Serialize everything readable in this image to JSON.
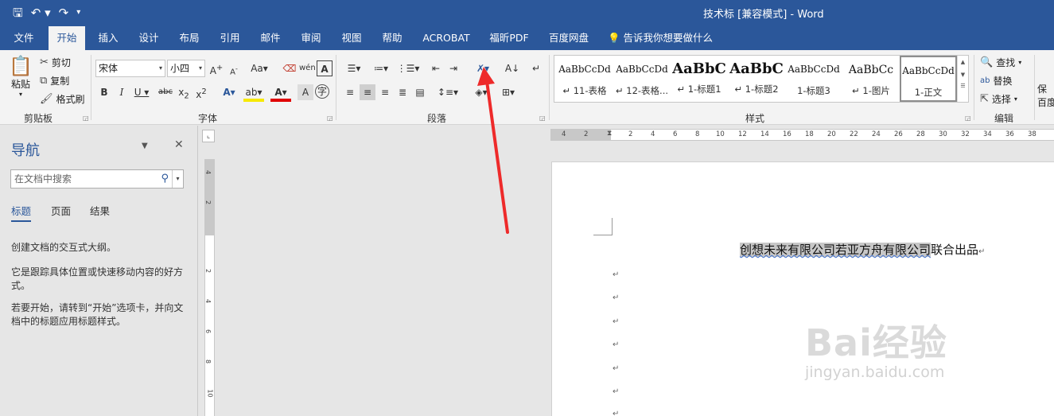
{
  "title_bar": {
    "title": "技术标 [兼容模式] - Word",
    "qat_icons": [
      "save-icon",
      "undo-icon",
      "redo-icon",
      "customize-icon"
    ]
  },
  "tabs": [
    {
      "label": "文件"
    },
    {
      "label": "开始"
    },
    {
      "label": "插入"
    },
    {
      "label": "设计"
    },
    {
      "label": "布局"
    },
    {
      "label": "引用"
    },
    {
      "label": "邮件"
    },
    {
      "label": "审阅"
    },
    {
      "label": "视图"
    },
    {
      "label": "帮助"
    },
    {
      "label": "ACROBAT"
    },
    {
      "label": "福昕PDF"
    },
    {
      "label": "百度网盘"
    }
  ],
  "tell_me": "告诉我你想要做什么",
  "ribbon": {
    "clipboard": {
      "paste": "粘贴",
      "cut": "剪切",
      "copy": "复制",
      "format_painter": "格式刷",
      "label": "剪贴板"
    },
    "font": {
      "font_name": "宋体",
      "font_size": "小四",
      "label": "字体"
    },
    "paragraph": {
      "label": "段落"
    },
    "styles": {
      "label": "样式",
      "items": [
        {
          "preview": "AaBbCcDd",
          "name": "↵ 11-表格"
        },
        {
          "preview": "AaBbCcDd",
          "name": "↵ 12-表格..."
        },
        {
          "preview": "AaBbC",
          "name": "↵ 1-标题1"
        },
        {
          "preview": "AaBbC",
          "name": "↵ 1-标题2"
        },
        {
          "preview": "AaBbCcDd",
          "name": "1-标题3"
        },
        {
          "preview": "AaBbCc",
          "name": "↵ 1-图片"
        },
        {
          "preview": "AaBbCcDd",
          "name": "1-正文"
        }
      ]
    },
    "editing": {
      "find": "查找",
      "replace": "替换",
      "select": "选择",
      "label": "编辑"
    },
    "save_partial": {
      "line1": "保",
      "line2": "百度"
    }
  },
  "nav": {
    "title": "导航",
    "search_placeholder": "在文档中搜索",
    "tabs": [
      "标题",
      "页面",
      "结果"
    ],
    "p1": "创建文档的交互式大纲。",
    "p2": "它是跟踪具体位置或快速移动内容的好方式。",
    "p3": "若要开始，请转到“开始”选项卡，并向文档中的标题应用标题样式。"
  },
  "ruler": {
    "h_numbers": [
      "4",
      "2",
      "2",
      "4",
      "6",
      "8",
      "10",
      "12",
      "14",
      "16",
      "18",
      "20",
      "22",
      "24",
      "26",
      "28",
      "30",
      "32",
      "34",
      "36",
      "38"
    ],
    "v_numbers": [
      "4",
      "2",
      "2",
      "4",
      "6",
      "8",
      "10"
    ]
  },
  "document": {
    "line_highlight": "创想未来有限公司若亚方舟有限公司",
    "line_rest": "联合出品",
    "para_mark": "↵"
  },
  "watermark": {
    "brand": "Bai经验",
    "url": "jingyan.baidu.com"
  },
  "colors": {
    "accent": "#2b579a",
    "ribbon": "#f3f3f3",
    "annotation_arrow": "#ee2a2a"
  }
}
